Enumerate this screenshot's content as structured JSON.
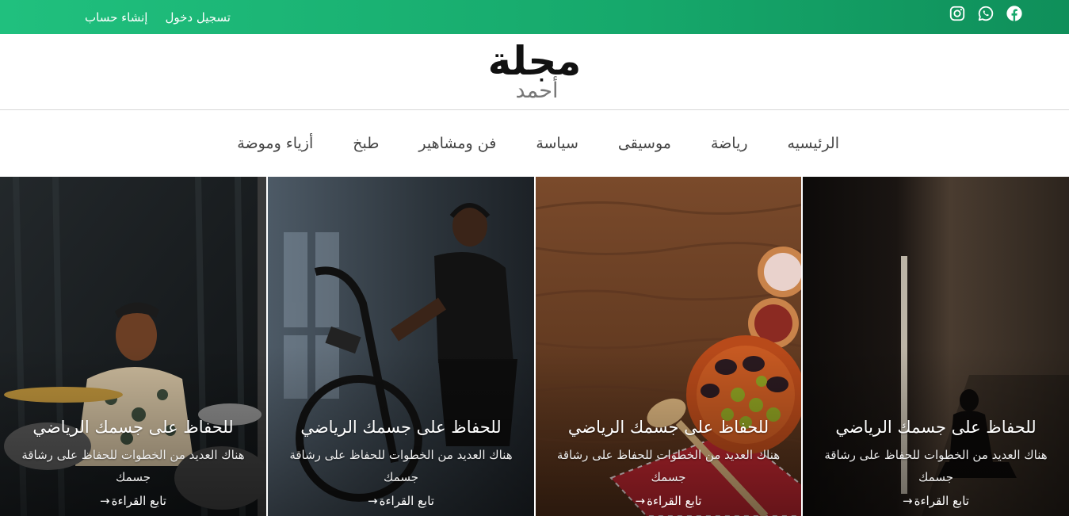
{
  "topbar": {
    "login_label": "تسجيل دخول",
    "register_label": "إنشاء حساب",
    "social": [
      "facebook-icon",
      "whatsapp-icon",
      "instagram-icon"
    ],
    "accent_start": "#20c07e",
    "accent_end": "#0f8f5a"
  },
  "logo": {
    "main": "مجلة",
    "sub": "أحمد"
  },
  "nav": {
    "items": [
      {
        "label": "الرئيسيه"
      },
      {
        "label": "رياضة"
      },
      {
        "label": "موسيقى"
      },
      {
        "label": "سياسة"
      },
      {
        "label": "فن ومشاهير"
      },
      {
        "label": "طبخ"
      },
      {
        "label": "أزياء وموضة"
      }
    ]
  },
  "cards": [
    {
      "title": "للحفاظ على جسمك الرياضي",
      "desc": "هناك العديد من الخطوات للحفاظ على رشاقة جسمك",
      "more": "تابع القراءة",
      "image": "drummer-photo"
    },
    {
      "title": "للحفاظ على جسمك الرياضي",
      "desc": "هناك العديد من الخطوات للحفاظ على رشاقة جسمك",
      "more": "تابع القراءة",
      "image": "exercise-bike-photo"
    },
    {
      "title": "للحفاظ على جسمك الرياضي",
      "desc": "هناك العديد من الخطوات للحفاظ على رشاقة جسمك",
      "more": "تابع القراءة",
      "image": "food-table-photo"
    },
    {
      "title": "للحفاظ على جسمك الرياضي",
      "desc": "هناك العديد من الخطوات للحفاظ على رشاقة جسمك",
      "more": "تابع القراءة",
      "image": "dark-room-photo"
    }
  ]
}
